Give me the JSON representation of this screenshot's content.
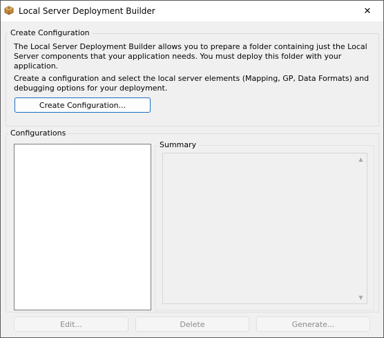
{
  "window": {
    "title": "Local Server Deployment Builder",
    "close_glyph": "✕"
  },
  "create_group": {
    "legend": "Create Configuration",
    "description_1": "The Local Server Deployment Builder allows you to prepare a folder containing just the Local Server components that your application needs. You must deploy this folder with your application.",
    "description_2": "Create a configuration and select the local server elements (Mapping, GP, Data Formats) and debugging options for your deployment.",
    "create_button_label": "Create Configuration..."
  },
  "configurations_group": {
    "legend": "Configurations",
    "items": [],
    "summary_legend": "Summary",
    "summary_text": "",
    "scroll_up_glyph": "▲",
    "scroll_down_glyph": "▼"
  },
  "actions": {
    "edit_label": "Edit...",
    "delete_label": "Delete",
    "generate_label": "Generate..."
  }
}
